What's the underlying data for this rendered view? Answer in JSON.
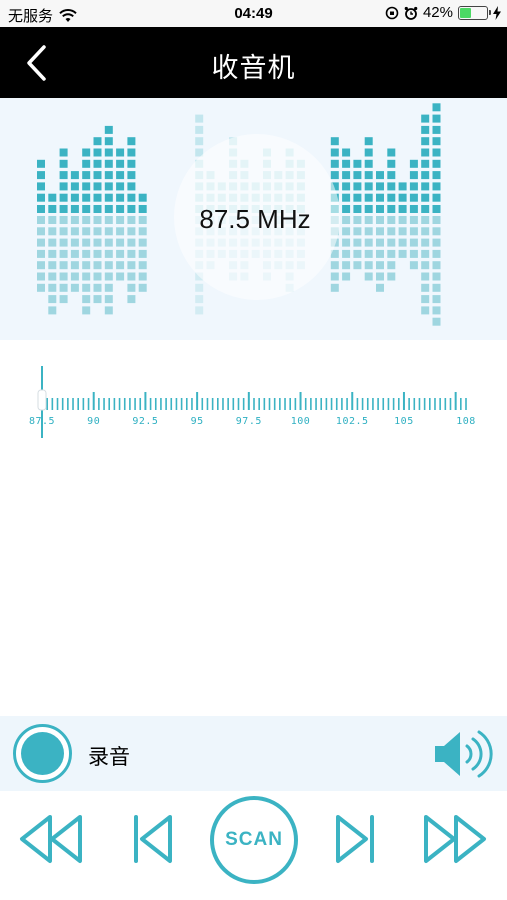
{
  "status_bar": {
    "carrier": "无服务",
    "time": "04:49",
    "battery_percent": "42%",
    "battery_level": 0.42,
    "icons": [
      "wifi-icon",
      "orientation-lock-icon",
      "alarm-icon",
      "battery-icon",
      "charging-bolt-icon"
    ]
  },
  "nav": {
    "title": "收音机",
    "back_icon": "chevron-left-icon"
  },
  "radio": {
    "frequency": "87.5 MHz",
    "band_min": 87.5,
    "band_max": 108,
    "current_value": 87.5,
    "scale_labels": [
      "87.5",
      "90",
      "92.5",
      "95",
      "97.5",
      "100",
      "102.5",
      "105",
      "108"
    ]
  },
  "record": {
    "label": "录音",
    "icon": "record-icon"
  },
  "controls": {
    "scan_label": "SCAN",
    "icons": [
      "fast-rewind-icon",
      "previous-icon",
      "next-icon",
      "fast-forward-icon",
      "speaker-icon"
    ]
  },
  "colors": {
    "accent": "#3bb3c3",
    "accent_light": "#9fd6e0",
    "nav_bg": "#000000",
    "panel_bg": "#f0f7fd"
  }
}
